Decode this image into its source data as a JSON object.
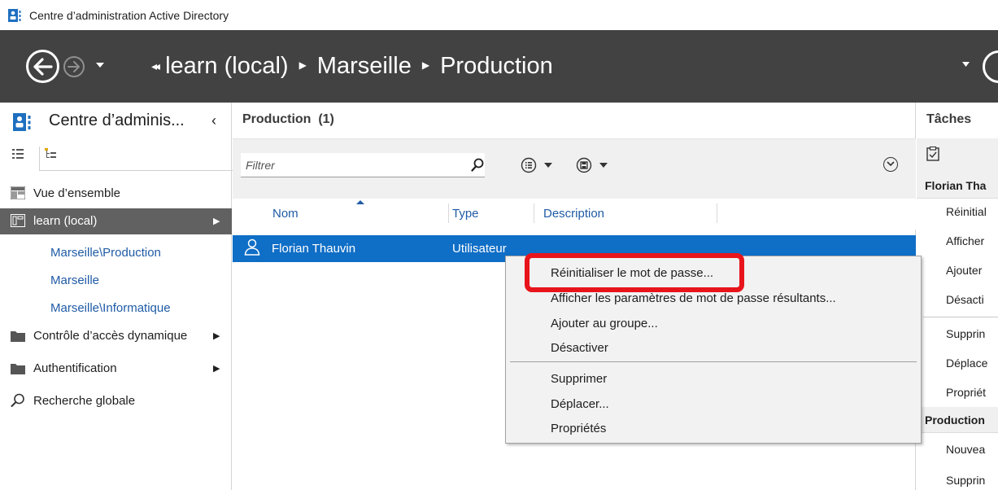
{
  "window": {
    "title": "Centre d’administration Active Directory"
  },
  "breadcrumb": {
    "items": [
      "learn (local)",
      "Marseille",
      "Production"
    ]
  },
  "left_pane": {
    "title": "Centre d’adminis...",
    "items": {
      "overview": "Vue d’ensemble",
      "domain": "learn (local)",
      "dynamic_access": "Contrôle d’accès dynamique",
      "authentication": "Authentification",
      "global_search": "Recherche globale"
    },
    "sub_items": [
      "Marseille\\Production",
      "Marseille",
      "Marseille\\Informatique"
    ]
  },
  "center_pane": {
    "title": "Production  (1)",
    "filter_placeholder": "Filtrer",
    "columns": [
      "Nom",
      "Type",
      "Description"
    ],
    "rows": [
      {
        "name": "Florian Thauvin",
        "type": "Utilisateur",
        "description": ""
      }
    ]
  },
  "context_menu": {
    "items": [
      "Réinitialiser le mot de passe...",
      "Afficher les paramètres de mot de passe résultants...",
      "Ajouter au groupe...",
      "Désactiver",
      "Supprimer",
      "Déplacer...",
      "Propriétés"
    ]
  },
  "right_pane": {
    "title": "Tâches",
    "section1": "Florian Tha",
    "items1": [
      "Réinitial",
      "Afficher",
      "Ajouter",
      "Désacti",
      "Supprin",
      "Déplace",
      "Propriét"
    ],
    "section2": "Production",
    "items2": [
      "Nouvea",
      "Supprin"
    ]
  },
  "colors": {
    "header_bg": "#424242",
    "selection_blue": "#0f6ec6",
    "link_blue": "#1f5ba6",
    "highlight_red": "#e8141b",
    "nav_selected": "#616161"
  }
}
